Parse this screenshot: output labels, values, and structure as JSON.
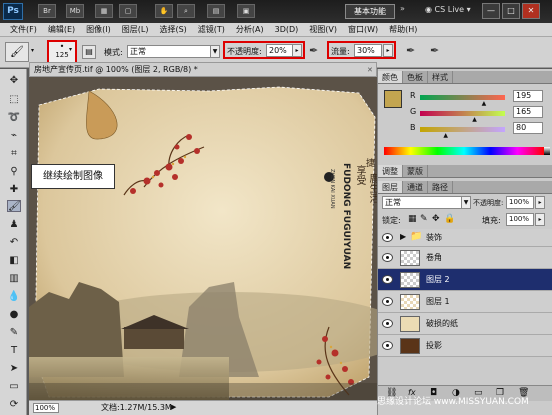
{
  "app": {
    "logo": "Ps",
    "workspace": "基本功能",
    "cs_live": "CS Live"
  },
  "title_icons": [
    "Br",
    "Mb"
  ],
  "window_buttons": [
    "—",
    "□",
    "✕"
  ],
  "menu": [
    "文件(F)",
    "编辑(E)",
    "图像(I)",
    "图层(L)",
    "选择(S)",
    "滤镜(T)",
    "分析(A)",
    "3D(D)",
    "视图(V)",
    "窗口(W)",
    "帮助(H)"
  ],
  "options": {
    "brush_size": "125",
    "mode_label": "模式:",
    "mode_value": "正常",
    "opacity_label": "不透明度:",
    "opacity_value": "20%",
    "flow_label": "流量:",
    "flow_value": "30%"
  },
  "document": {
    "tab_title": "房地产宣传页.tif @ 100% (图层 2, RGB/8) *",
    "zoom": "100%",
    "doc_info": "文档:1.27M/15.3M",
    "vertical_text": "FUDONG FUGUIYUAN",
    "vertical_text_2": "ZHEN KAI XUAN",
    "poster_line_1": "享受",
    "poster_line_2": "鹿生活",
    "poster_line_3": "捷"
  },
  "callout": "继续绘制图像",
  "color_panel": {
    "tabs": [
      "颜色",
      "色板",
      "样式"
    ],
    "channels": [
      {
        "label": "R",
        "value": "195",
        "fraction": 0.76
      },
      {
        "label": "G",
        "value": "165",
        "fraction": 0.65
      },
      {
        "label": "B",
        "value": "80",
        "fraction": 0.31
      }
    ],
    "swatch": "#c3a550"
  },
  "adjust_tabs": [
    "调整",
    "蒙版"
  ],
  "layers_panel": {
    "tabs": [
      "图层",
      "通道",
      "路径"
    ],
    "blend_mode": "正常",
    "opacity_label": "不透明度:",
    "opacity_value": "100%",
    "lock_label": "锁定:",
    "fill_label": "填充:",
    "fill_value": "100%",
    "layers": [
      {
        "name": "装饰",
        "type": "group",
        "selected": false
      },
      {
        "name": "卷角",
        "type": "layer",
        "selected": false
      },
      {
        "name": "图层 2",
        "type": "layer",
        "selected": true
      },
      {
        "name": "图层 1",
        "type": "layer",
        "selected": false
      },
      {
        "name": "破损的纸",
        "type": "layer",
        "selected": false
      },
      {
        "name": "投影",
        "type": "layer",
        "selected": false
      }
    ],
    "bottom_icons": [
      "link-icon",
      "fx-icon",
      "mask-icon",
      "adjustment-icon",
      "folder-icon",
      "new-layer-icon",
      "trash-icon"
    ]
  },
  "watermark": "思缘设计论坛 www.MISSYUAN.COM"
}
